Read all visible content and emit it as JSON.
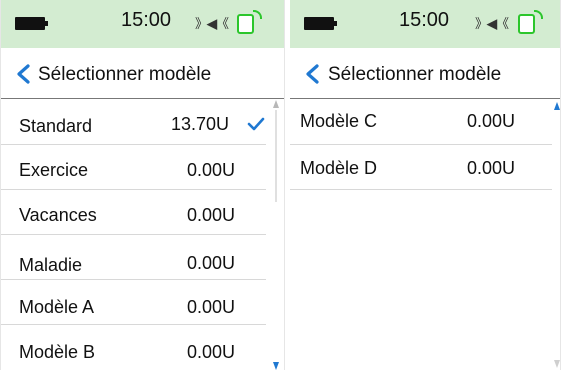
{
  "accent_color": "#1f78d1",
  "status_bar_color": "#d3ecd1",
  "screens": [
    {
      "status": {
        "time": "15:00",
        "battery_icon": "battery-full-icon",
        "mute_icon": "sound-muted-icon",
        "device_icon": "device-connected-icon"
      },
      "header": {
        "back_icon": "chevron-left-icon",
        "title": "Sélectionner modèle"
      },
      "rows": [
        {
          "name": "Standard",
          "value": "13.70U",
          "selected": true
        },
        {
          "name": "Exercice",
          "value": "0.00U"
        },
        {
          "name": "Vacances",
          "value": "0.00U"
        },
        {
          "name": "Maladie",
          "value": "0.00U"
        },
        {
          "name": "Modèle A",
          "value": "0.00U"
        },
        {
          "name": "Modèle B",
          "value": "0.00U"
        }
      ]
    },
    {
      "status": {
        "time": "15:00",
        "battery_icon": "battery-full-icon",
        "mute_icon": "sound-muted-icon",
        "device_icon": "device-connected-icon"
      },
      "header": {
        "back_icon": "chevron-left-icon",
        "title": "Sélectionner modèle"
      },
      "rows": [
        {
          "name": "Modèle C",
          "value": "0.00U"
        },
        {
          "name": "Modèle D",
          "value": "0.00U"
        }
      ]
    }
  ]
}
